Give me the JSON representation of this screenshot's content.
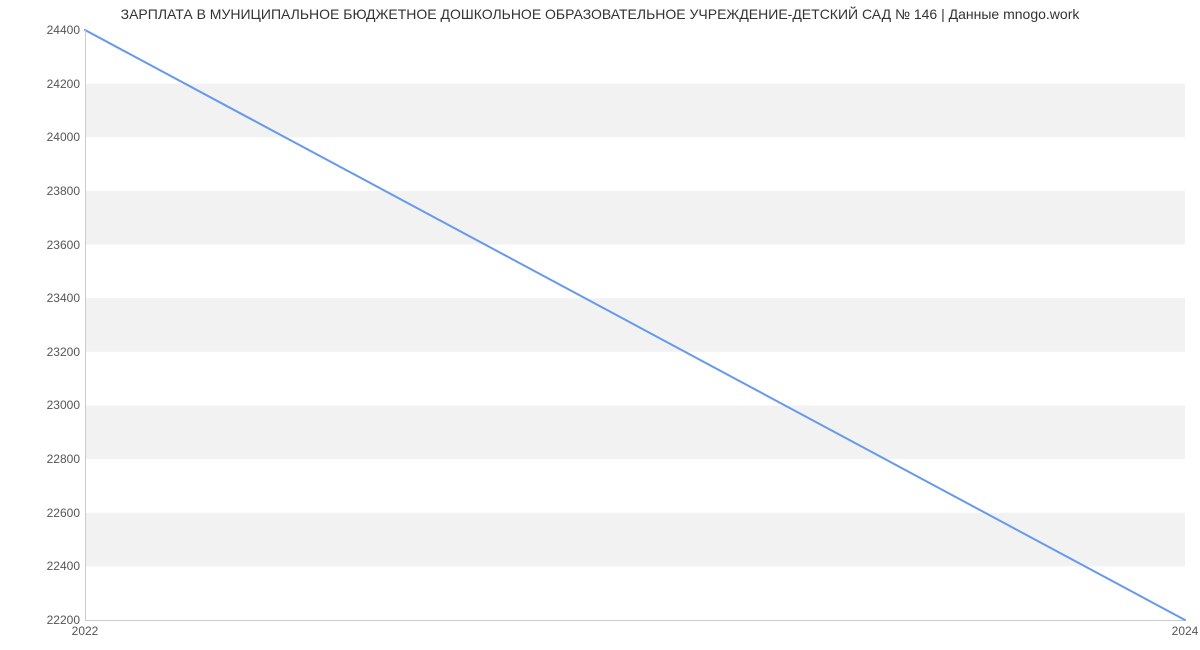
{
  "chart_data": {
    "type": "line",
    "title": "ЗАРПЛАТА В МУНИЦИПАЛЬНОЕ БЮДЖЕТНОЕ ДОШКОЛЬНОЕ ОБРАЗОВАТЕЛЬНОЕ УЧРЕЖДЕНИЕ-ДЕТСКИЙ САД № 146 | Данные mnogo.work",
    "x": [
      2022,
      2024
    ],
    "values": [
      24400,
      22200
    ],
    "x_ticks": [
      2022,
      2024
    ],
    "y_ticks": [
      22200,
      22400,
      22600,
      22800,
      23000,
      23200,
      23400,
      23600,
      23800,
      24000,
      24200,
      24400
    ],
    "ylim": [
      22200,
      24400
    ],
    "xlim": [
      2022,
      2024
    ],
    "line_color": "#6699ee",
    "grid_band_color": "#f2f2f2",
    "xlabel": "",
    "ylabel": ""
  }
}
